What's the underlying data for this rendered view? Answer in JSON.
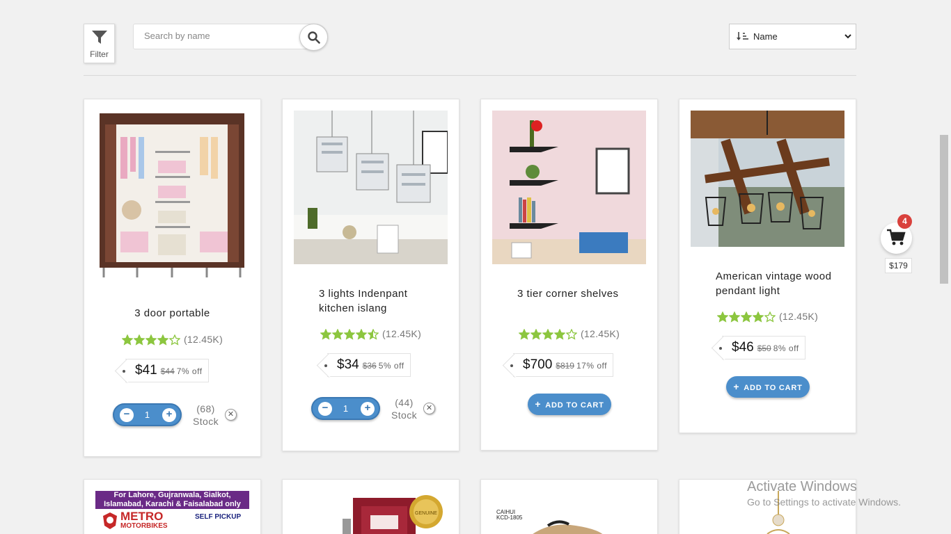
{
  "toolbar": {
    "filter_label": "Filter",
    "search_placeholder": "Search by name",
    "sort_value": "Name"
  },
  "products": [
    {
      "name": "3 door portable",
      "rating": 4,
      "rating_count": "(12.45K)",
      "price": "$41",
      "old_price": "$44",
      "discount": "7% off",
      "quantity": "1",
      "stock_count": "(68)",
      "stock_label": "Stock"
    },
    {
      "name": "3 lights Indenpant kitchen islang",
      "rating": 4.5,
      "rating_count": "(12.45K)",
      "price": "$34",
      "old_price": "$36",
      "discount": "5% off",
      "quantity": "1",
      "stock_count": "(44)",
      "stock_label": "Stock"
    },
    {
      "name": "3 tier corner shelves",
      "rating": 4,
      "rating_count": "(12.45K)",
      "price": "$700",
      "old_price": "$819",
      "discount": "17% off",
      "button": "ADD TO CART"
    },
    {
      "name": "American vintage wood pendant light",
      "rating": 4,
      "rating_count": "(12.45K)",
      "price": "$46",
      "old_price": "$50",
      "discount": "8% off",
      "button": "ADD TO CART"
    }
  ],
  "bottom_row": {
    "promo_line1": "For Lahore, Gujranwala, Sialkot,",
    "promo_line2": "Islamabad, Karachi & Faisalabad only",
    "promo_brand1": "METRO",
    "promo_brand2": "MOTORBIKES",
    "promo_pickup": "SELF PICKUP",
    "seal_text": "GENUINE",
    "shoe_brand": "CAIHUI",
    "shoe_model": "KCD-1805"
  },
  "cart": {
    "count": "4",
    "total": "$179"
  },
  "watermark": {
    "line1": "Activate Windows",
    "line2": "Go to Settings to activate Windows."
  },
  "colors": {
    "accent": "#4b8ecb",
    "star": "#8cc63f",
    "badge": "#d9413c"
  }
}
